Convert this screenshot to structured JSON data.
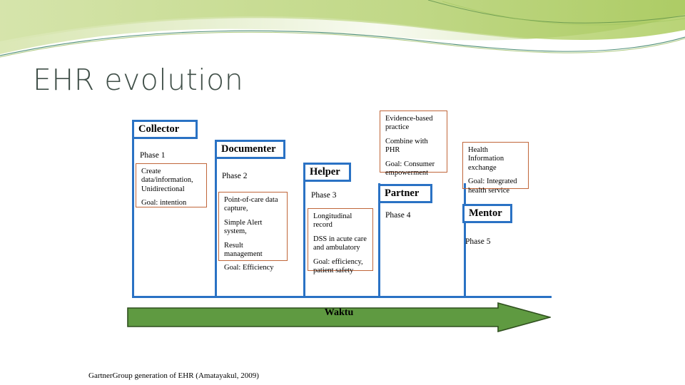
{
  "slide": {
    "title": "EHR evolution",
    "source_note": "GartnerGroup generation of EHR (Amatayakul, 2009)",
    "time_axis_label": "Waktu",
    "colors": {
      "title_text": "#404f48",
      "frame_blue": "#2a72c4",
      "detail_orange": "#c0663a",
      "arrow_green": "#5f9a41",
      "arrow_outline": "#2f4f1e",
      "wave_light_green": "#dbe8b8",
      "wave_mid_green": "#c3d98a",
      "wave_dark_green": "#3f7a3c"
    }
  },
  "stages": [
    {
      "role": "Collector",
      "phase": "Phase 1",
      "details": [
        "Create data/information, Unidirectional",
        "Goal: intention"
      ]
    },
    {
      "role": "Documenter",
      "phase": "Phase 2",
      "details": [
        "Point-of-care data capture,",
        "Simple Alert system,",
        "Result management",
        "Goal: Efficiency"
      ]
    },
    {
      "role": "Helper",
      "phase": "Phase 3",
      "details": [
        "Longitudinal record",
        "DSS in acute care and ambulatory",
        "Goal: efficiency, patient safety"
      ]
    },
    {
      "role": "Partner",
      "phase": "Phase 4",
      "details": [
        "Evidence-based practice",
        "Combine with PHR",
        "Goal: Consumer empowerment"
      ]
    },
    {
      "role": "Mentor",
      "phase": "Phase 5",
      "details": [
        "Health Information exchange",
        "Goal: Integrated health service"
      ]
    }
  ]
}
